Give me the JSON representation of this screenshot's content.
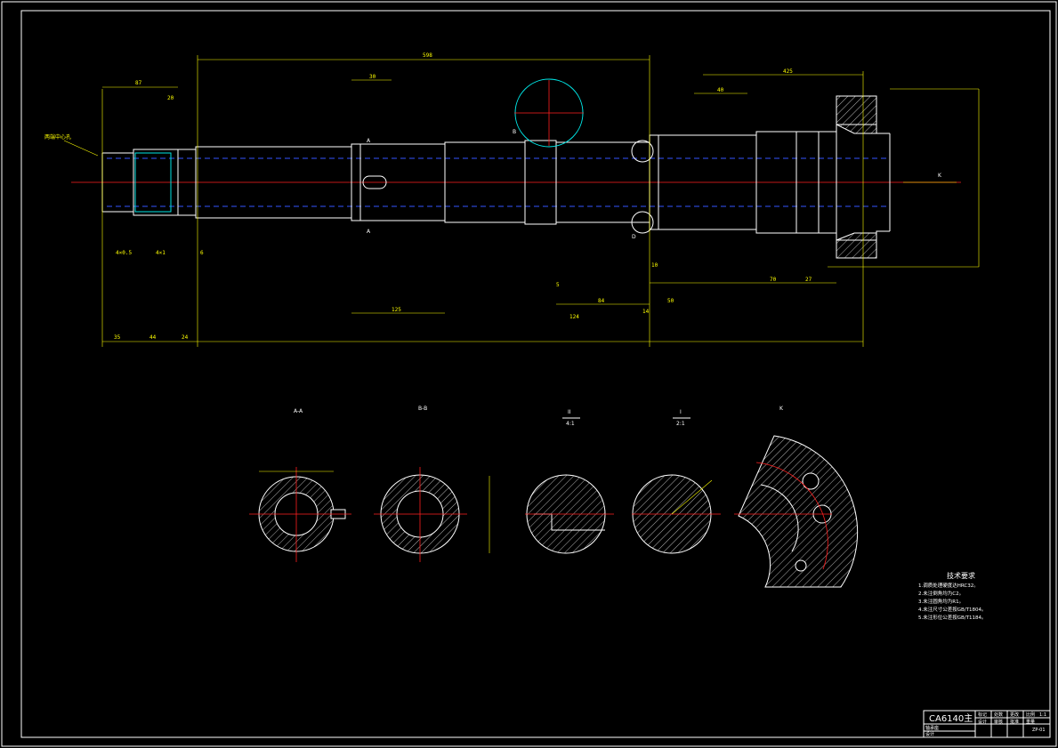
{
  "dimensions": {
    "overall_top": "598",
    "d_87": "87",
    "d_30": "30",
    "d_20": "20",
    "d_40": "40",
    "d_425": "425",
    "d_35": "35",
    "d_44": "44",
    "d_24": "24",
    "d_125": "125",
    "d_84": "84",
    "d_124": "124",
    "d_50": "50",
    "d_70": "70",
    "d_27": "27",
    "d_10": "10",
    "d_5": "5",
    "d_6": "6",
    "d_14": "14",
    "d_4x1": "4×1",
    "d_4x05": "4×0.5"
  },
  "labels": {
    "center_hole": "两端中心孔",
    "section_a": "A",
    "section_b": "B",
    "view_k": "K",
    "view_d": "D"
  },
  "sections": {
    "aa": "A-A",
    "bb": "B-B",
    "ii": "II",
    "ii_scale": "4:1",
    "i": "I",
    "i_scale": "2:1",
    "k": "K"
  },
  "requirements": {
    "title": "技术要求",
    "items": [
      "1.调质处理硬度达HRC32。",
      "2.未注倒角均为C2。",
      "3.未注圆角均为R1。",
      "4.未注尺寸公差按GB/T1804。",
      "5.未注形位公差按GB/T1184。"
    ]
  },
  "title_block": {
    "name": "CA6140主",
    "row1": [
      "标记",
      "处数",
      "更改",
      "比例"
    ],
    "row2": [
      "设计",
      "审核",
      "批准",
      "重量"
    ],
    "scale": "1:1",
    "code": "ZP-01",
    "side1": "轴承座",
    "side2": "设计"
  },
  "colors": {
    "background": "#000000",
    "outline": "#ffffff",
    "dimension": "#ffff00",
    "centerline": "#ff2020",
    "hidden": "#3355ff",
    "highlight": "#00e5e5"
  }
}
